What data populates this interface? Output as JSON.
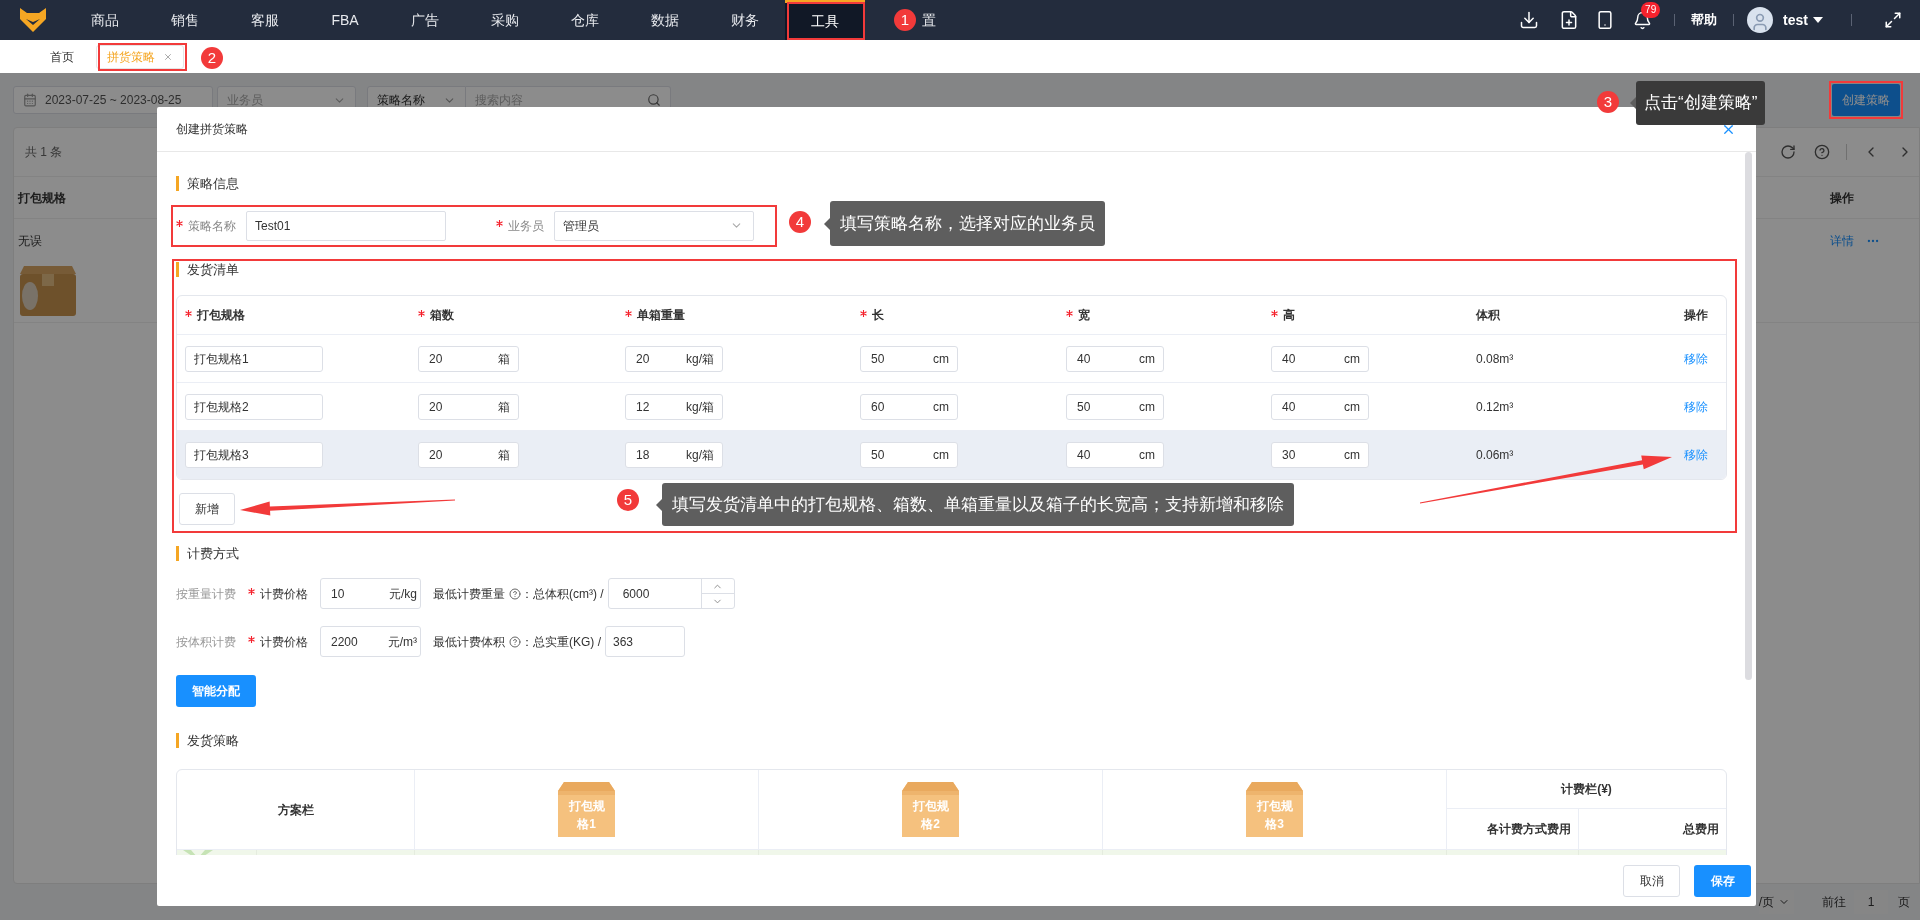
{
  "top_nav": {
    "items": [
      {
        "label": "商品",
        "selected": false
      },
      {
        "label": "销售",
        "selected": false
      },
      {
        "label": "客服",
        "selected": false
      },
      {
        "label": "FBA",
        "selected": false
      },
      {
        "label": "广告",
        "selected": false
      },
      {
        "label": "采购",
        "selected": false
      },
      {
        "label": "仓库",
        "selected": false
      },
      {
        "label": "数据",
        "selected": false
      },
      {
        "label": "财务",
        "selected": false
      },
      {
        "label": "工具",
        "selected": true
      },
      {
        "label": "置",
        "selected": false
      }
    ],
    "notification_count": "79",
    "help": "帮助",
    "user": "test"
  },
  "page_tabs": [
    {
      "label": "首页",
      "selected": false,
      "closable": false
    },
    {
      "label": "拼货策略",
      "selected": true,
      "closable": true
    }
  ],
  "background_page": {
    "date_range": "2023-07-25 ~ 2023-08-25",
    "salesperson_placeholder": "业务员",
    "search_by": "策略名称",
    "search_placeholder": "搜索内容",
    "create_button": "创建策略",
    "total": "共 1 条",
    "column_1": "打包规格",
    "actions_column": "操作",
    "row_cell": "无误",
    "row_actions": [
      "详情"
    ],
    "pagination": {
      "page_size": "/页",
      "goto": "前往",
      "page": "1",
      "page_suffix": "页"
    }
  },
  "modal": {
    "title": "创建拼货策略",
    "strategy_info": {
      "heading": "策略信息",
      "fields": [
        {
          "label": "策略名称",
          "required": true,
          "value": "Test01",
          "kind": "input"
        },
        {
          "label": "业务员",
          "required": true,
          "value": "管理员",
          "kind": "select"
        }
      ]
    },
    "shipping_list": {
      "heading": "发货清单",
      "columns": [
        {
          "label": "打包规格",
          "required": true
        },
        {
          "label": "箱数",
          "required": true
        },
        {
          "label": "单箱重量",
          "required": true
        },
        {
          "label": "长",
          "required": true
        },
        {
          "label": "宽",
          "required": true
        },
        {
          "label": "高",
          "required": true
        },
        {
          "label": "体积",
          "required": false
        },
        {
          "label": "操作",
          "required": false
        }
      ],
      "rows": [
        {
          "hovered": false,
          "cells": [
            {
              "kind": "input",
              "value": "打包规格1"
            },
            {
              "kind": "unit",
              "value": "20",
              "unit": "箱"
            },
            {
              "kind": "unit",
              "value": "20",
              "unit": "kg/箱"
            },
            {
              "kind": "unit",
              "value": "50",
              "unit": "cm"
            },
            {
              "kind": "unit",
              "value": "40",
              "unit": "cm"
            },
            {
              "kind": "unit",
              "value": "40",
              "unit": "cm"
            },
            {
              "kind": "text",
              "value": "0.08m³"
            },
            {
              "kind": "link",
              "value": "移除"
            }
          ]
        },
        {
          "hovered": false,
          "cells": [
            {
              "kind": "input",
              "value": "打包规格2"
            },
            {
              "kind": "unit",
              "value": "20",
              "unit": "箱"
            },
            {
              "kind": "unit",
              "value": "12",
              "unit": "kg/箱"
            },
            {
              "kind": "unit",
              "value": "60",
              "unit": "cm"
            },
            {
              "kind": "unit",
              "value": "50",
              "unit": "cm"
            },
            {
              "kind": "unit",
              "value": "40",
              "unit": "cm"
            },
            {
              "kind": "text",
              "value": "0.12m³"
            },
            {
              "kind": "link",
              "value": "移除"
            }
          ]
        },
        {
          "hovered": true,
          "cells": [
            {
              "kind": "input",
              "value": "打包规格3"
            },
            {
              "kind": "unit",
              "value": "20",
              "unit": "箱"
            },
            {
              "kind": "unit",
              "value": "18",
              "unit": "kg/箱"
            },
            {
              "kind": "unit",
              "value": "50",
              "unit": "cm"
            },
            {
              "kind": "unit",
              "value": "40",
              "unit": "cm"
            },
            {
              "kind": "unit",
              "value": "30",
              "unit": "cm"
            },
            {
              "kind": "text",
              "value": "0.06m³"
            },
            {
              "kind": "link",
              "value": "移除"
            }
          ]
        }
      ],
      "add_button": "新增"
    },
    "billing": {
      "heading": "计费方式",
      "rows": [
        {
          "mode": "按重量计费",
          "price_label": "计费价格",
          "required": true,
          "price": "10",
          "price_unit": "元/kg",
          "min_label": "最低计费重量",
          "formula": "：总体积(cm³) /",
          "divisor": "6000",
          "stepper": true
        },
        {
          "mode": "按体积计费",
          "price_label": "计费价格",
          "required": true,
          "price": "2200",
          "price_unit": "元/m³",
          "min_label": "最低计费体积",
          "formula": "：总实重(KG) /",
          "divisor": "363",
          "stepper": false
        }
      ],
      "allocate_button": "智能分配"
    },
    "strategy": {
      "heading": "发货策略",
      "plan_column": "方案栏",
      "specs": [
        "打包规格1",
        "打包规格2",
        "打包规格3"
      ],
      "fee_group": "计费栏(¥)",
      "fee_columns": [
        "各计费方式费用",
        "总费用"
      ]
    },
    "footer": {
      "cancel": "取消",
      "save": "保存"
    }
  },
  "annotations": [
    {
      "number": "1"
    },
    {
      "number": "2"
    },
    {
      "number": "3",
      "tip": "点击“创建策略”"
    },
    {
      "number": "4",
      "tip": "填写策略名称，选择对应的业务员"
    },
    {
      "number": "5",
      "tip": "填写发货清单中的打包规格、箱数、单箱重量以及箱子的长宽高；支持新增和移除"
    }
  ]
}
